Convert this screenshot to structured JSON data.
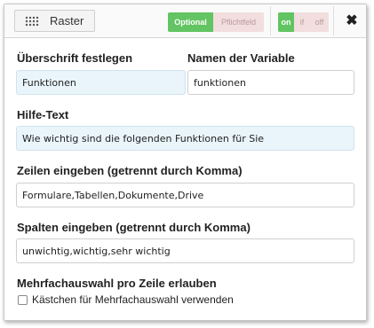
{
  "toolbar": {
    "type_label": "Raster",
    "type_icon": "grid-icon",
    "optional_label": "Optional",
    "required_label": "Pflichtfeld",
    "on_label": "on",
    "if_label": "if",
    "off_label": "off",
    "close_glyph": "✖"
  },
  "form": {
    "heading_label": "Überschrift festlegen",
    "heading_value": "Funktionen",
    "variable_label": "Namen der Variable",
    "variable_value": "funktionen",
    "help_label": "Hilfe-Text",
    "help_value": "Wie wichtig sind die folgenden Funktionen für Sie",
    "rows_label": "Zeilen eingeben (getrennt durch Komma)",
    "rows_value": "Formulare,Tabellen,Dokumente,Drive",
    "cols_label": "Spalten eingeben (getrennt durch Komma)",
    "cols_value": "unwichtig,wichtig,sehr wichtig",
    "multi_label": "Mehrfachauswahl pro Zeile erlauben",
    "multi_checkbox_label": "Kästchen für Mehrfachauswahl verwenden",
    "multi_checked": false
  },
  "colors": {
    "active_green": "#62c462",
    "inactive_pink": "#f2dede",
    "input_highlight": "#eaf5fb"
  }
}
